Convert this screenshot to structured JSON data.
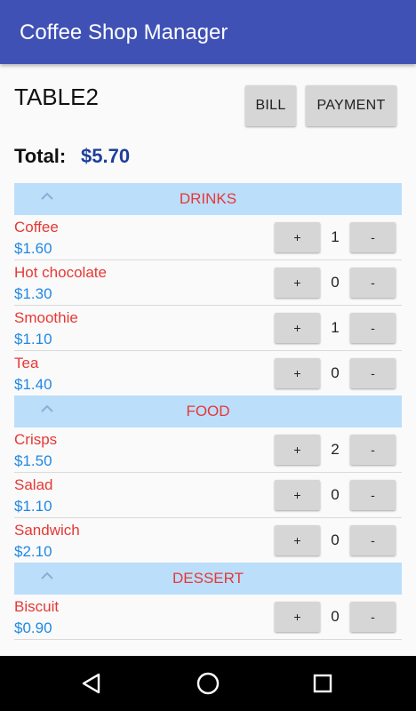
{
  "app_title": "Coffee Shop Manager",
  "table_name": "TABLE2",
  "buttons": {
    "bill": "BILL",
    "payment": "PAYMENT"
  },
  "total": {
    "label": "Total:",
    "value": "$5.70"
  },
  "colors": {
    "app_bar": "#3f51b5",
    "category_bg": "#bbdefb",
    "item_name": "#e53935",
    "item_price": "#1e88e5",
    "total_value": "#1e3f9a"
  },
  "item_controls": {
    "plus": "+",
    "minus": "-"
  },
  "categories": [
    {
      "name": "DRINKS",
      "items": [
        {
          "name": "Coffee",
          "price": "$1.60",
          "qty": "1"
        },
        {
          "name": "Hot chocolate",
          "price": "$1.30",
          "qty": "0"
        },
        {
          "name": "Smoothie",
          "price": "$1.10",
          "qty": "1"
        },
        {
          "name": "Tea",
          "price": "$1.40",
          "qty": "0"
        }
      ]
    },
    {
      "name": "FOOD",
      "items": [
        {
          "name": "Crisps",
          "price": "$1.50",
          "qty": "2"
        },
        {
          "name": "Salad",
          "price": "$1.10",
          "qty": "0"
        },
        {
          "name": "Sandwich",
          "price": "$2.10",
          "qty": "0"
        }
      ]
    },
    {
      "name": "DESSERT",
      "items": [
        {
          "name": "Biscuit",
          "price": "$0.90",
          "qty": "0"
        }
      ]
    }
  ],
  "nav_icons": [
    "back-icon",
    "home-icon",
    "recents-icon"
  ]
}
